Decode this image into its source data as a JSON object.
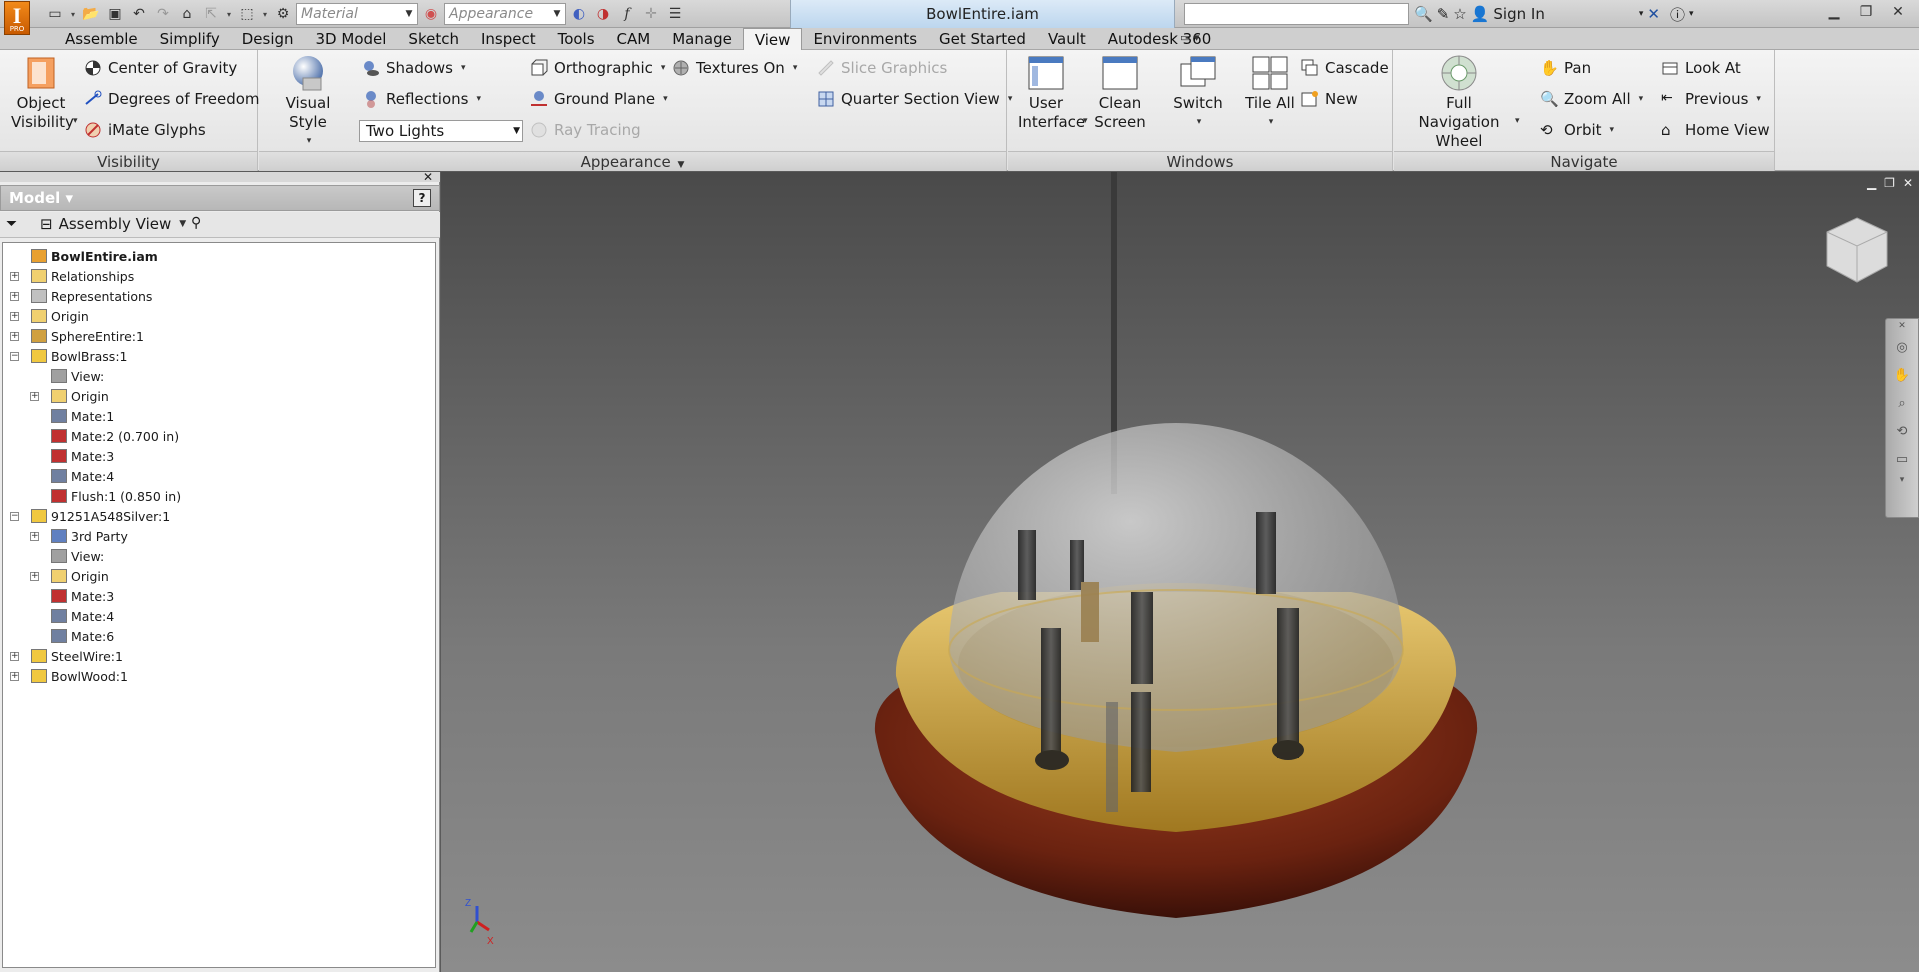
{
  "app": {
    "logo_letter": "I",
    "logo_sub": "PRO",
    "document_title": "BowlEntire.iam",
    "material_placeholder": "Material",
    "appearance_placeholder": "Appearance",
    "sign_in": "Sign In"
  },
  "tabs": [
    "Assemble",
    "Simplify",
    "Design",
    "3D Model",
    "Sketch",
    "Inspect",
    "Tools",
    "CAM",
    "Manage",
    "View",
    "Environments",
    "Get Started",
    "Vault",
    "Autodesk 360"
  ],
  "active_tab": "View",
  "ribbon": {
    "visibility": {
      "label": "Visibility",
      "object_visibility": "Object Visibility",
      "center_of_gravity": "Center of Gravity",
      "degrees_of_freedom": "Degrees of Freedom",
      "imate_glyphs": "iMate Glyphs"
    },
    "appearance": {
      "label": "Appearance",
      "visual_style": "Visual Style",
      "shadows": "Shadows",
      "reflections": "Reflections",
      "lighting": "Two Lights",
      "orthographic": "Orthographic",
      "ground_plane": "Ground Plane",
      "ray_tracing": "Ray Tracing",
      "textures_on": "Textures On",
      "slice_graphics": "Slice Graphics",
      "quarter_section_view": "Quarter Section View"
    },
    "windows": {
      "label": "Windows",
      "user_interface": "User Interface",
      "clean_screen": "Clean Screen",
      "switch": "Switch",
      "tile_all": "Tile All",
      "cascade": "Cascade",
      "new": "New"
    },
    "navigate": {
      "label": "Navigate",
      "full_navigation_wheel": "Full Navigation Wheel",
      "pan": "Pan",
      "zoom_all": "Zoom All",
      "orbit": "Orbit",
      "look_at": "Look At",
      "previous": "Previous",
      "home_view": "Home View"
    }
  },
  "browser": {
    "title": "Model",
    "view_mode": "Assembly View",
    "tree": [
      {
        "label": "BowlEntire.iam",
        "level": 0,
        "expander": "",
        "icon": "assembly-icon"
      },
      {
        "label": "Relationships",
        "level": 0,
        "expander": "+",
        "icon": "folder-icon"
      },
      {
        "label": "Representations",
        "level": 0,
        "expander": "+",
        "icon": "representations-icon"
      },
      {
        "label": "Origin",
        "level": 0,
        "expander": "+",
        "icon": "folder-icon"
      },
      {
        "label": "SphereEntire:1",
        "level": 0,
        "expander": "+",
        "icon": "subassembly-icon"
      },
      {
        "label": "BowlBrass:1",
        "level": 0,
        "expander": "-",
        "icon": "part-icon"
      },
      {
        "label": "View:",
        "level": 1,
        "expander": "",
        "icon": "view-rep-icon"
      },
      {
        "label": "Origin",
        "level": 1,
        "expander": "+",
        "icon": "folder-icon"
      },
      {
        "label": "Mate:1",
        "level": 1,
        "expander": "",
        "icon": "mate-icon"
      },
      {
        "label": "Mate:2 (0.700 in)",
        "level": 1,
        "expander": "",
        "icon": "mate-offset-icon"
      },
      {
        "label": "Mate:3",
        "level": 1,
        "expander": "",
        "icon": "mate-offset-icon"
      },
      {
        "label": "Mate:4",
        "level": 1,
        "expander": "",
        "icon": "mate-icon"
      },
      {
        "label": "Flush:1 (0.850 in)",
        "level": 1,
        "expander": "",
        "icon": "flush-icon"
      },
      {
        "label": "91251A548Silver:1",
        "level": 0,
        "expander": "-",
        "icon": "part-icon"
      },
      {
        "label": "3rd Party",
        "level": 1,
        "expander": "+",
        "icon": "third-party-icon"
      },
      {
        "label": "View:",
        "level": 1,
        "expander": "",
        "icon": "view-rep-icon"
      },
      {
        "label": "Origin",
        "level": 1,
        "expander": "+",
        "icon": "folder-icon"
      },
      {
        "label": "Mate:3",
        "level": 1,
        "expander": "",
        "icon": "mate-offset-icon"
      },
      {
        "label": "Mate:4",
        "level": 1,
        "expander": "",
        "icon": "mate-icon"
      },
      {
        "label": "Mate:6",
        "level": 1,
        "expander": "",
        "icon": "mate-icon"
      },
      {
        "label": "SteelWire:1",
        "level": 0,
        "expander": "+",
        "icon": "part-icon"
      },
      {
        "label": "BowlWood:1",
        "level": 0,
        "expander": "+",
        "icon": "part-icon"
      }
    ]
  },
  "viewport": {
    "triad_z": "Z",
    "triad_x": "X",
    "colors": {
      "wood": "#7a2e14",
      "brass": "#c8a040",
      "glass": "#b8b8b8"
    }
  }
}
